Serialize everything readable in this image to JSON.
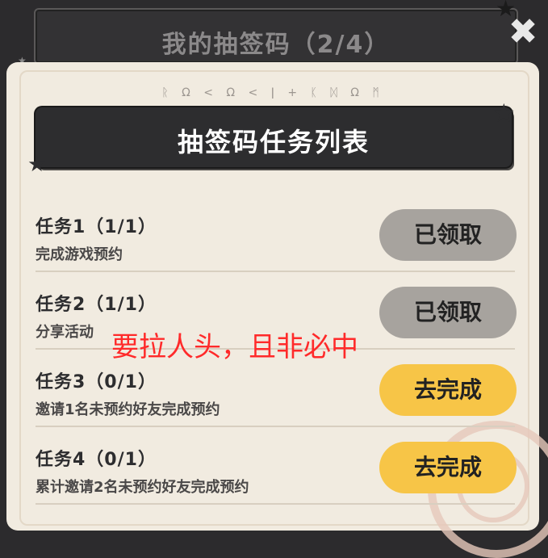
{
  "top_card": {
    "title": "我的抽签码（2/4）"
  },
  "close_label": "✖",
  "panel": {
    "cipher": "ᚱ Ω < Ω < ǀ + ᛕ ᛞ Ω ᛗ",
    "header_title": "抽签码任务列表"
  },
  "tasks": [
    {
      "title": "任务1（1/1）",
      "desc": "完成游戏预约",
      "button": "已领取",
      "status": "claimed"
    },
    {
      "title": "任务2（1/1）",
      "desc": "分享活动",
      "button": "已领取",
      "status": "claimed"
    },
    {
      "title": "任务3（0/1）",
      "desc": "邀请1名未预约好友完成预约",
      "button": "去完成",
      "status": "todo"
    },
    {
      "title": "任务4（0/1）",
      "desc": "累计邀请2名未预约好友完成预约",
      "button": "去完成",
      "status": "todo"
    }
  ],
  "annotation": "要拉人头，且非必中",
  "colors": {
    "claimed_button": "#a7a39e",
    "todo_button": "#f7c547",
    "annotation": "#ff2a2a",
    "header_bg": "#2d2d2f"
  }
}
